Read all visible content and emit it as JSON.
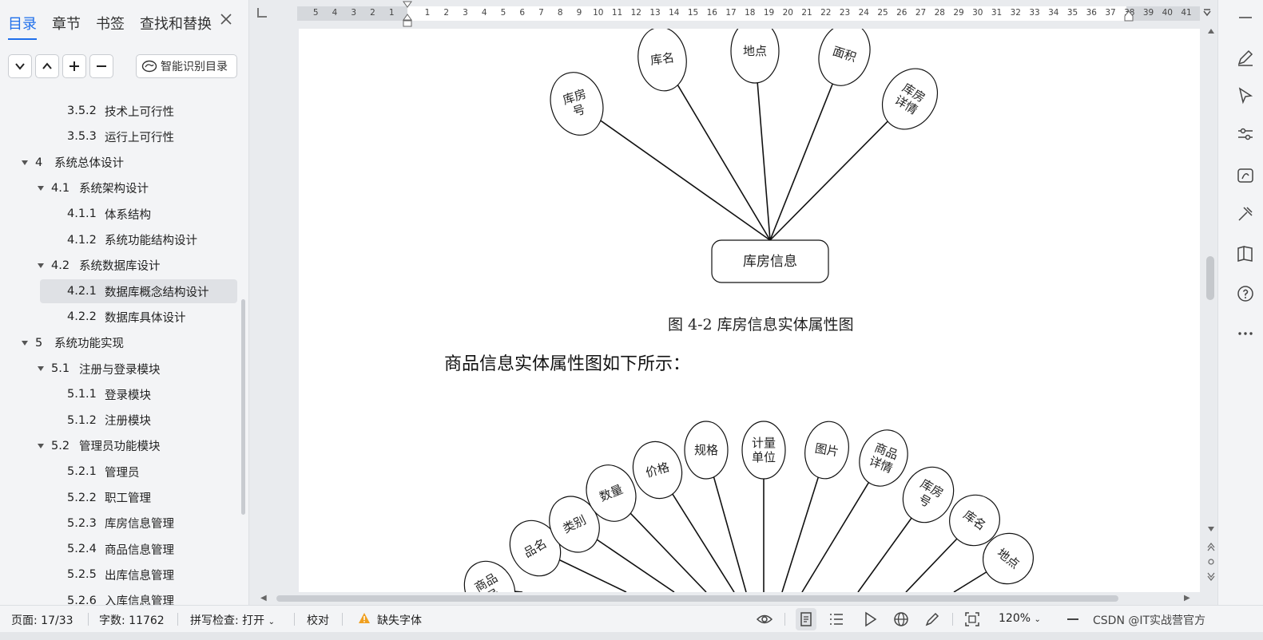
{
  "nav": {
    "tabs": [
      "目录",
      "章节",
      "书签",
      "查找和替换"
    ],
    "smart_toc_label": "智能识别目录",
    "toc": [
      {
        "num": "3.5.2",
        "text": "技术上可行性",
        "level": 3
      },
      {
        "num": "3.5.3",
        "text": "运行上可行性",
        "level": 3
      },
      {
        "num": "4",
        "text": "系统总体设计",
        "level": 1,
        "expanded": true
      },
      {
        "num": "4.1",
        "text": "系统架构设计",
        "level": 2,
        "expanded": true
      },
      {
        "num": "4.1.1",
        "text": "体系结构",
        "level": 3
      },
      {
        "num": "4.1.2",
        "text": "系统功能结构设计",
        "level": 3
      },
      {
        "num": "4.2",
        "text": "系统数据库设计",
        "level": 2,
        "expanded": true
      },
      {
        "num": "4.2.1",
        "text": "数据库概念结构设计",
        "level": 3,
        "selected": true
      },
      {
        "num": "4.2.2",
        "text": "数据库具体设计",
        "level": 3
      },
      {
        "num": "5",
        "text": "系统功能实现",
        "level": 1,
        "expanded": true
      },
      {
        "num": "5.1",
        "text": "注册与登录模块",
        "level": 2,
        "expanded": true
      },
      {
        "num": "5.1.1",
        "text": "登录模块",
        "level": 3
      },
      {
        "num": "5.1.2",
        "text": "注册模块",
        "level": 3
      },
      {
        "num": "5.2",
        "text": "管理员功能模块",
        "level": 2,
        "expanded": true
      },
      {
        "num": "5.2.1",
        "text": "管理员",
        "level": 3
      },
      {
        "num": "5.2.2",
        "text": "职工管理",
        "level": 3
      },
      {
        "num": "5.2.3",
        "text": "库房信息管理",
        "level": 3
      },
      {
        "num": "5.2.4",
        "text": "商品信息管理",
        "level": 3
      },
      {
        "num": "5.2.5",
        "text": "出库信息管理",
        "level": 3
      },
      {
        "num": "5.2.6",
        "text": "入库信息管理",
        "level": 3
      }
    ]
  },
  "ruler": {
    "left_numbers": [
      "5",
      "4",
      "3",
      "2",
      "1"
    ],
    "right_numbers": [
      "1",
      "2",
      "3",
      "4",
      "5",
      "6",
      "7",
      "8",
      "9",
      "10",
      "11",
      "12",
      "13",
      "14",
      "15",
      "16",
      "17",
      "18",
      "19",
      "20",
      "21",
      "22",
      "23",
      "24",
      "25",
      "26",
      "27",
      "28",
      "29",
      "30",
      "31",
      "32",
      "33",
      "34",
      "35",
      "36",
      "37",
      "38",
      "39",
      "40",
      "41"
    ]
  },
  "document": {
    "figure1": {
      "entity": "库房信息",
      "attributes": [
        "库房号",
        "库名",
        "地点",
        "面积",
        "库房详情"
      ]
    },
    "caption": "图 4-2  库房信息实体属性图",
    "paragraph": "商品信息实体属性图如下所示：",
    "figure2": {
      "attributes": [
        "商品号",
        "品名",
        "类别",
        "数量",
        "价格",
        "规格",
        "计量单位",
        "图片",
        "商品详情",
        "库房号",
        "库名",
        "地点"
      ]
    }
  },
  "status": {
    "page": "页面: 17/33",
    "words": "字数: 11762",
    "spell": "拼写检查: 打开",
    "proof": "校对",
    "missing_font": "缺失字体",
    "zoom": "120%",
    "watermark": "CSDN @IT实战营官方"
  },
  "colors": {
    "accent": "#1f6feb",
    "warning": "#f0a020"
  }
}
